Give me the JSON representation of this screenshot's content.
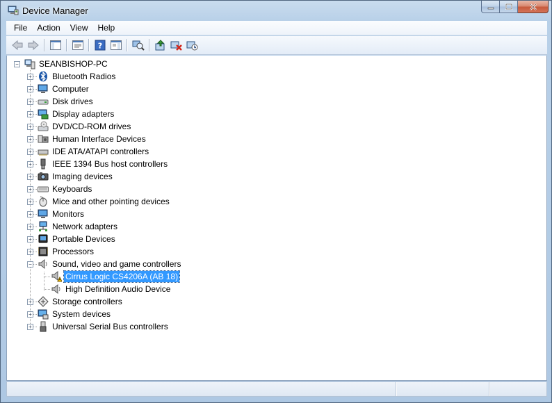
{
  "window": {
    "title": "Device Manager",
    "icon": "device-manager-icon",
    "controls": [
      "minimize-icon",
      "maximize-icon",
      "close-icon"
    ]
  },
  "menu": {
    "items": [
      {
        "label": "File"
      },
      {
        "label": "Action"
      },
      {
        "label": "View"
      },
      {
        "label": "Help"
      }
    ]
  },
  "toolbar": {
    "buttons": [
      {
        "icon": "back-arrow-icon"
      },
      {
        "icon": "forward-arrow-icon"
      },
      {
        "icon": "show-hide-console-tree-icon"
      },
      {
        "icon": "properties-icon"
      },
      {
        "icon": "help-icon"
      },
      {
        "icon": "show-hide-action-pane-icon"
      },
      {
        "icon": "scan-hardware-changes-icon"
      },
      {
        "icon": "update-driver-icon"
      },
      {
        "icon": "uninstall-icon"
      },
      {
        "icon": "disable-device-icon"
      }
    ]
  },
  "tree": {
    "root": {
      "label": "SEANBISHOP-PC",
      "icon": "computer-icon",
      "expanded": true
    },
    "categories": [
      {
        "label": "Bluetooth Radios",
        "icon": "bluetooth-icon",
        "expanded": false
      },
      {
        "label": "Computer",
        "icon": "computer-monitor-icon",
        "expanded": false
      },
      {
        "label": "Disk drives",
        "icon": "disk-drive-icon",
        "expanded": false
      },
      {
        "label": "Display adapters",
        "icon": "display-adapter-icon",
        "expanded": false
      },
      {
        "label": "DVD/CD-ROM drives",
        "icon": "dvd-drive-icon",
        "expanded": false
      },
      {
        "label": "Human Interface Devices",
        "icon": "hid-icon",
        "expanded": false
      },
      {
        "label": "IDE ATA/ATAPI controllers",
        "icon": "ide-controller-icon",
        "expanded": false
      },
      {
        "label": "IEEE 1394 Bus host controllers",
        "icon": "firewire-icon",
        "expanded": false
      },
      {
        "label": "Imaging devices",
        "icon": "camera-icon",
        "expanded": false
      },
      {
        "label": "Keyboards",
        "icon": "keyboard-icon",
        "expanded": false
      },
      {
        "label": "Mice and other pointing devices",
        "icon": "mouse-icon",
        "expanded": false
      },
      {
        "label": "Monitors",
        "icon": "monitor-icon",
        "expanded": false
      },
      {
        "label": "Network adapters",
        "icon": "network-adapter-icon",
        "expanded": false
      },
      {
        "label": "Portable Devices",
        "icon": "portable-device-icon",
        "expanded": false
      },
      {
        "label": "Processors",
        "icon": "processor-icon",
        "expanded": false
      },
      {
        "label": "Sound, video and game controllers",
        "icon": "speaker-icon",
        "expanded": true,
        "children": [
          {
            "label": "Cirrus Logic CS4206A (AB 18)",
            "icon": "speaker-warning-icon",
            "selected": true,
            "warning": true
          },
          {
            "label": "High Definition Audio Device",
            "icon": "speaker-icon",
            "selected": false,
            "warning": false
          }
        ]
      },
      {
        "label": "Storage controllers",
        "icon": "storage-controller-icon",
        "expanded": false
      },
      {
        "label": "System devices",
        "icon": "system-devices-icon",
        "expanded": false
      },
      {
        "label": "Universal Serial Bus controllers",
        "icon": "usb-icon",
        "expanded": false
      }
    ]
  },
  "colors": {
    "selection": "#3399ff",
    "warning": "#f5c400",
    "frame": "#b8d0e8"
  }
}
